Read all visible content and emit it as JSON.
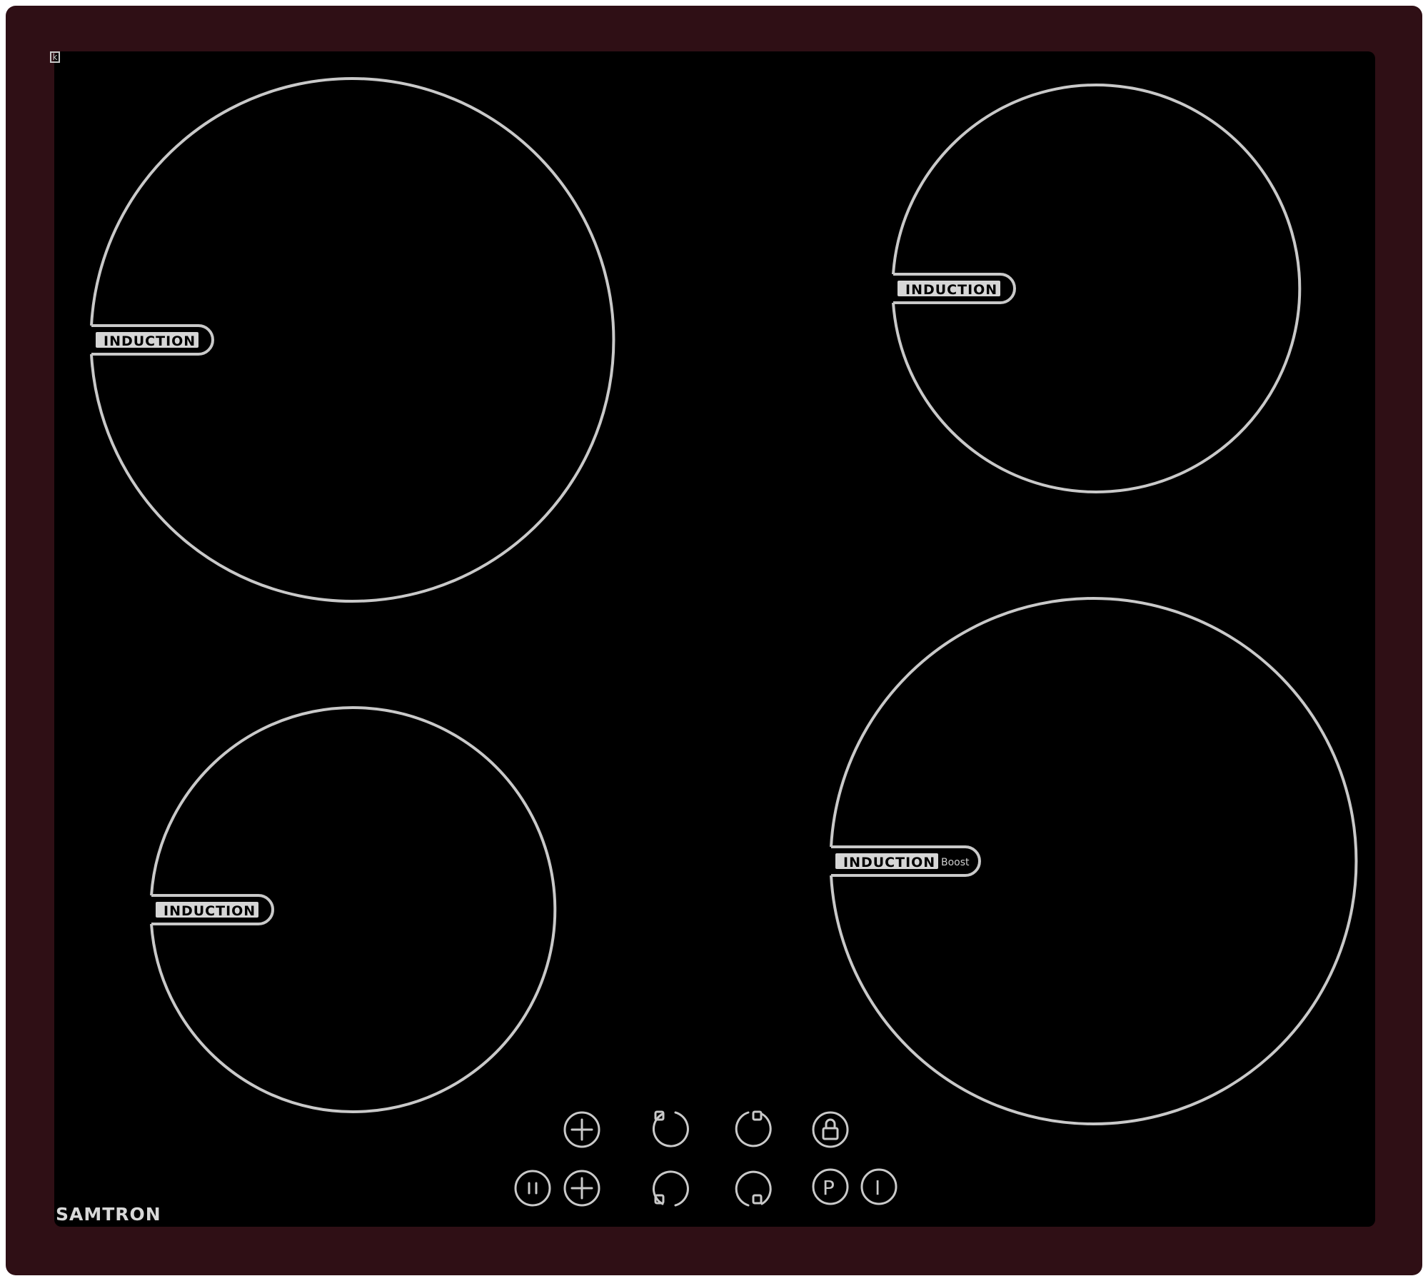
{
  "brand": "SAMTRON",
  "zones": [
    {
      "label": "INDUCTION",
      "extra": ""
    },
    {
      "label": "INDUCTION",
      "extra": ""
    },
    {
      "label": "INDUCTION",
      "extra": ""
    },
    {
      "label": "INDUCTION",
      "extra": "Boost"
    }
  ],
  "controls": [
    {
      "name": "plus-upper-icon"
    },
    {
      "name": "zone-rear-left-icon"
    },
    {
      "name": "zone-rear-right-icon"
    },
    {
      "name": "lock-icon"
    },
    {
      "name": "pause-icon"
    },
    {
      "name": "plus-lower-icon"
    },
    {
      "name": "zone-front-left-icon"
    },
    {
      "name": "zone-front-right-icon"
    },
    {
      "name": "power-boost-icon",
      "text": "P"
    },
    {
      "name": "power-icon",
      "text": "I"
    }
  ],
  "colors": {
    "frame": "#2f0f15",
    "glass": "#000000",
    "print": "#c9c9c9"
  }
}
